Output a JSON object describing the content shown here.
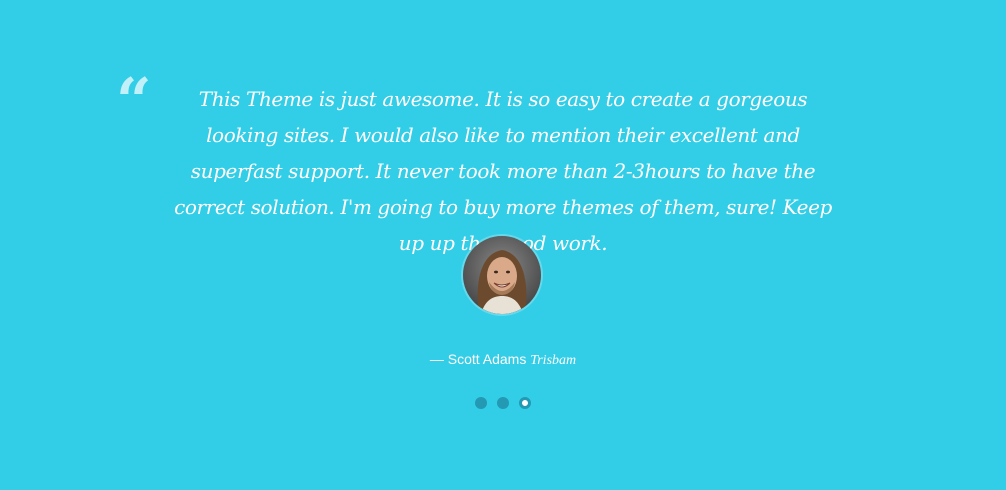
{
  "testimonial": {
    "quote_mark": "“",
    "text": "This Theme is just awesome. It is so easy to create a gorgeous looking sites. I would also like to mention their excellent and superfast support. It never took more than 2-3hours to have the correct solution. I'm going to buy more themes of them, sure! Keep up up the good work.",
    "author_prefix": "— ",
    "author_name": "Scott Adams",
    "author_company": "Trisbam"
  },
  "carousel": {
    "dots": 3,
    "active_index": 2
  },
  "colors": {
    "background": "#32cde6",
    "dot": "#2499b3",
    "text": "#ffffff"
  }
}
